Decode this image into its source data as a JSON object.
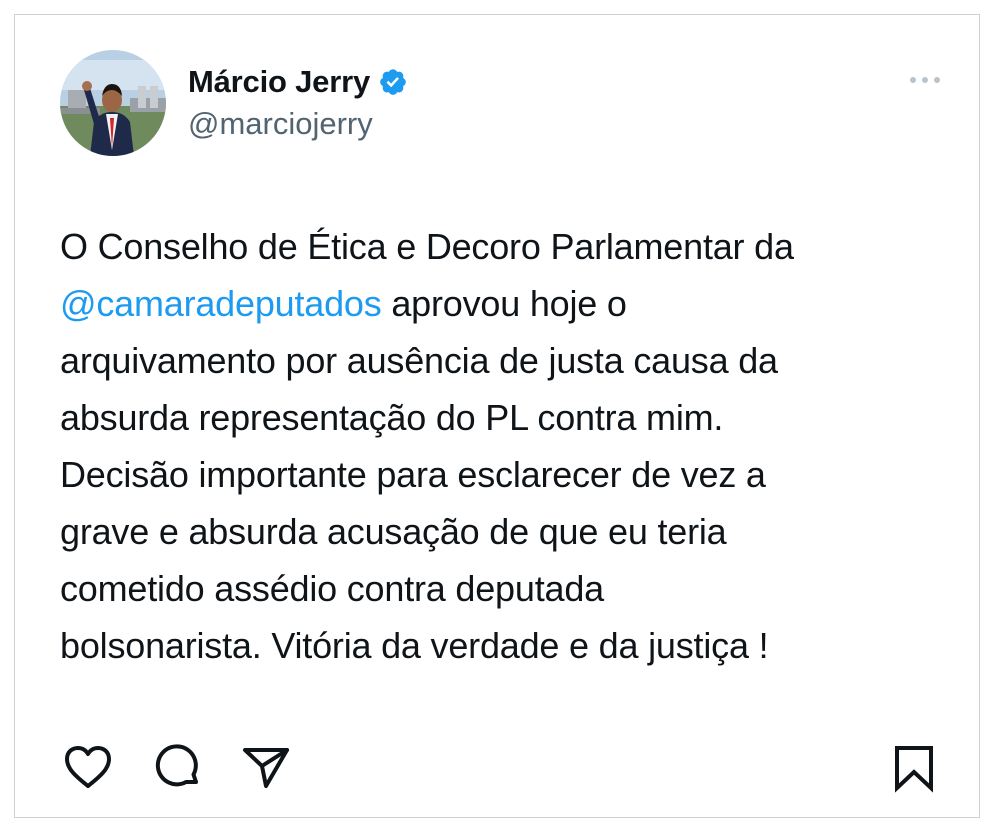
{
  "author": {
    "display_name": "Márcio Jerry",
    "handle": "@marciojerry"
  },
  "tweet": {
    "line1": "O Conselho de Ética e Decoro Parlamentar da",
    "line2_mention": "@camaradeputados",
    "line2_rest": " aprovou hoje o",
    "line3": "arquivamento por ausência de justa causa da",
    "line4": "absurda representação do PL contra mim.",
    "line5": "Decisão importante para esclarecer de vez a",
    "line6": "grave e absurda acusação de que eu teria",
    "line7": "cometido assédio contra deputada",
    "line8": "bolsonarista. Vitória da verdade e da justiça !"
  },
  "icons": {
    "avatar": "profile-photo",
    "verified": "verified-badge-icon",
    "more": "more-options-icon",
    "like": "heart-icon",
    "comment": "comment-bubble-icon",
    "share": "send-arrow-icon",
    "save": "bookmark-icon"
  },
  "colors": {
    "text": "#0f1419",
    "secondary": "#536471",
    "link": "#1d9bf0",
    "verified": "#1d9bf0"
  }
}
